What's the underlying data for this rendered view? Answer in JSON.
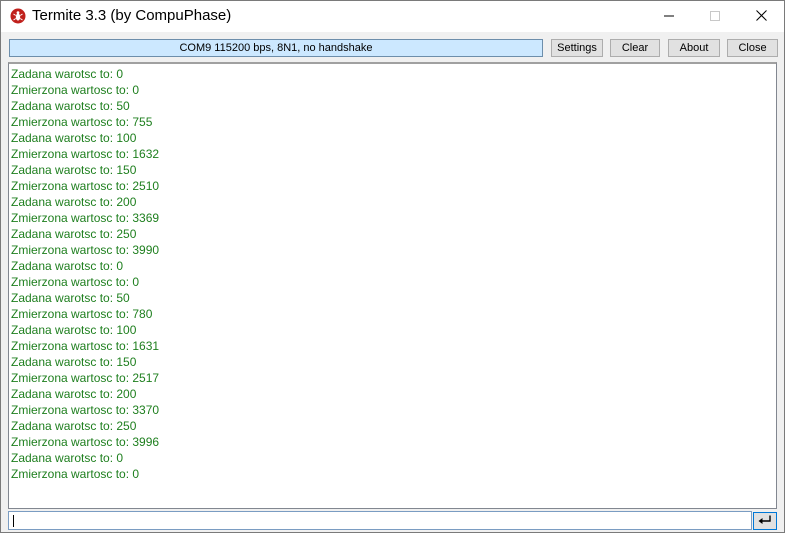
{
  "window": {
    "title": "Termite 3.3 (by CompuPhase)"
  },
  "icons": {
    "app": "termite-app-icon",
    "minimize": "minimize-icon",
    "maximize": "maximize-icon",
    "close": "close-icon",
    "send": "enter-return-icon"
  },
  "colors": {
    "status_bg": "#cce8ff",
    "terminal_text": "#1e7f1e"
  },
  "toolbar": {
    "status": "COM9 115200 bps, 8N1, no handshake",
    "settings_label": "Settings",
    "clear_label": "Clear",
    "about_label": "About",
    "close_label": "Close"
  },
  "terminal": {
    "lines": [
      "Zadana warotsc to: 0",
      "Zmierzona wartosc to: 0",
      "Zadana warotsc to: 50",
      "Zmierzona wartosc to: 755",
      "Zadana warotsc to: 100",
      "Zmierzona wartosc to: 1632",
      "Zadana warotsc to: 150",
      "Zmierzona wartosc to: 2510",
      "Zadana warotsc to: 200",
      "Zmierzona wartosc to: 3369",
      "Zadana warotsc to: 250",
      "Zmierzona wartosc to: 3990",
      "Zadana warotsc to: 0",
      "Zmierzona wartosc to: 0",
      "Zadana warotsc to: 50",
      "Zmierzona wartosc to: 780",
      "Zadana warotsc to: 100",
      "Zmierzona wartosc to: 1631",
      "Zadana warotsc to: 150",
      "Zmierzona wartosc to: 2517",
      "Zadana warotsc to: 200",
      "Zmierzona wartosc to: 3370",
      "Zadana warotsc to: 250",
      "Zmierzona wartosc to: 3996",
      "Zadana warotsc to: 0",
      "Zmierzona wartosc to: 0"
    ]
  },
  "input": {
    "value": ""
  }
}
